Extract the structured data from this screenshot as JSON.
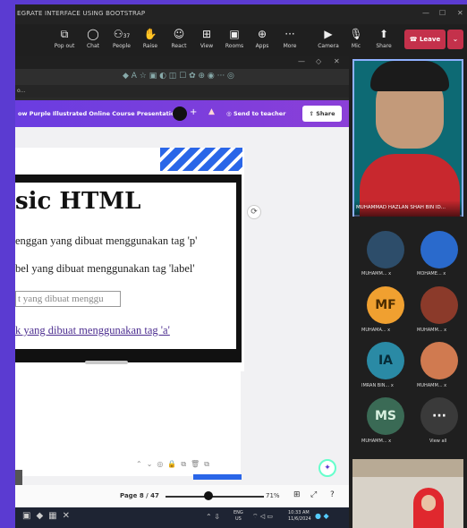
{
  "window": {
    "title": "EGRATE INTERFACE USING BOOTSTRAP"
  },
  "toolbar": {
    "items": [
      {
        "label": "Pop out",
        "icon": "popout-icon"
      },
      {
        "label": "Chat",
        "icon": "chat-icon"
      },
      {
        "label": "People",
        "icon": "people-icon",
        "count": "37"
      },
      {
        "label": "Raise",
        "icon": "hand-icon"
      },
      {
        "label": "React",
        "icon": "smile-icon"
      },
      {
        "label": "View",
        "icon": "grid-icon"
      },
      {
        "label": "Rooms",
        "icon": "rooms-icon"
      },
      {
        "label": "Apps",
        "icon": "apps-icon"
      },
      {
        "label": "More",
        "icon": "more-icon"
      },
      {
        "label": "Camera",
        "icon": "camera-icon"
      },
      {
        "label": "Mic",
        "icon": "mic-icon"
      },
      {
        "label": "Share",
        "icon": "share-icon"
      }
    ],
    "leave": "Leave"
  },
  "browser": {
    "tab": "o..."
  },
  "canva": {
    "title": "ow Purple Illustrated Online Course Presentation",
    "send": "Send to teacher",
    "share": "Share"
  },
  "slide": {
    "title": "sic HTML",
    "p1": "enggan yang dibuat menggunakan tag 'p'",
    "p2": "bel yang dibuat menggunakan tag 'label'",
    "input": "t yang dibuat menggu",
    "link": "k yang dibuat menggunakan tag 'a'"
  },
  "pagebar": {
    "page": "Page 8 / 47",
    "zoom": "71%",
    "zoom_fraction": 0.6
  },
  "taskbar": {
    "lang": "ENG",
    "region": "US",
    "time": "10:33 AM",
    "date": "11/6/2024"
  },
  "panel": {
    "main_name": "MUHAMMAD HAZLAN SHAH BIN ID...",
    "tiles": [
      {
        "label": "",
        "name": "MUHAMM..."
      },
      {
        "label": "",
        "name": "MOHAME..."
      },
      {
        "label": "MF",
        "name": "MUHAMA..."
      },
      {
        "label": "",
        "name": "MUHAMM..."
      },
      {
        "label": "IA",
        "name": "IMRAN BIN..."
      },
      {
        "label": "",
        "name": "MUHAMM..."
      },
      {
        "label": "MS",
        "name": "MUHAMM..."
      },
      {
        "label": "···",
        "name": "View all"
      }
    ]
  },
  "colors": {
    "accent": "#5b3bd1",
    "leave": "#c4314b",
    "mf": "#f0a030",
    "ia": "#2a8aa5",
    "ms": "#3a6a55"
  }
}
